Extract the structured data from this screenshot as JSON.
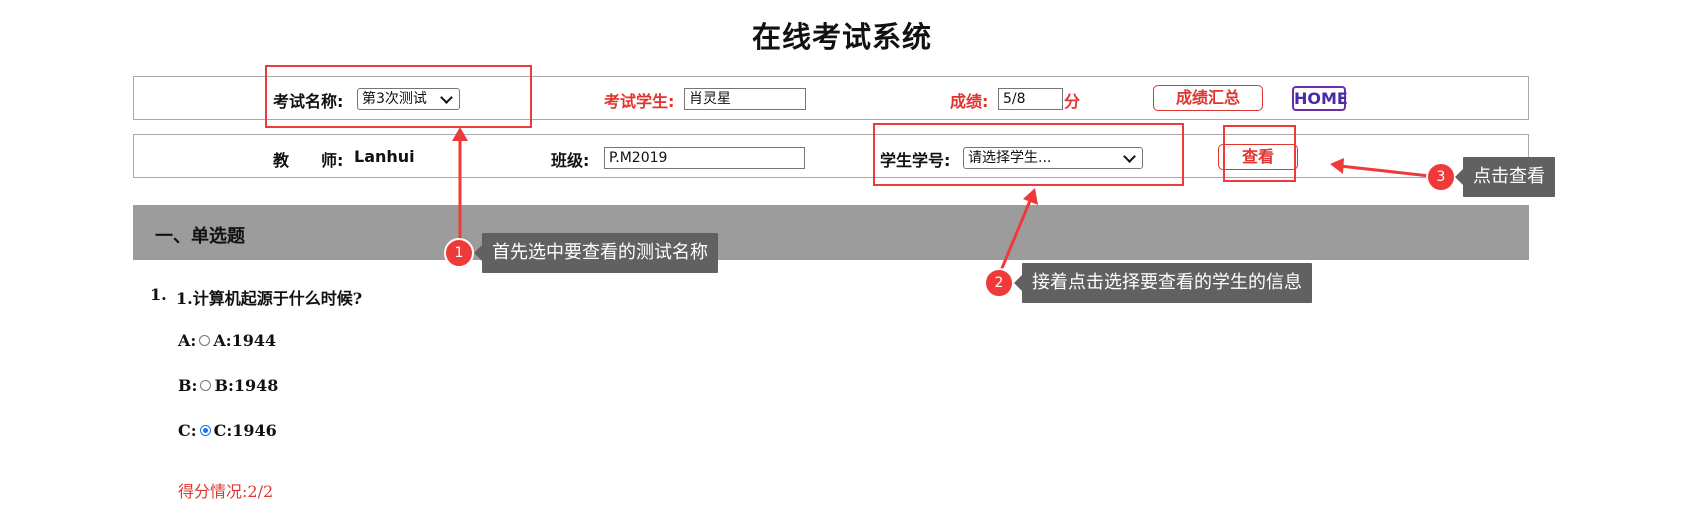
{
  "page": {
    "title": "在线考试系统"
  },
  "row1": {
    "exam_name_label": "考试名称:",
    "exam_name_selected": "第3次测试",
    "student_label": "考试学生:",
    "student_value": "肖灵星",
    "score_label": "成绩:",
    "score_value": "5/8",
    "score_unit": "分",
    "summary_button": "成绩汇总",
    "home_button": "HOME"
  },
  "row2": {
    "teacher_label": "教　　师:",
    "teacher_name": "Lanhui",
    "class_label": "班级:",
    "class_value": "P.M2019",
    "student_id_label": "学生学号:",
    "student_id_placeholder": "请选择学生...",
    "view_button": "查看"
  },
  "section": {
    "title": "一、单选题"
  },
  "question": {
    "number": "1.",
    "text": "1.计算机起源于什么时候?",
    "options": [
      {
        "prefix": "A:",
        "label": "A:1944",
        "checked": false
      },
      {
        "prefix": "B:",
        "label": "B:1948",
        "checked": false
      },
      {
        "prefix": "C:",
        "label": "C:1946",
        "checked": true
      }
    ],
    "score_text": "得分情况:2/2"
  },
  "annotations": [
    {
      "number": "1",
      "text": "首先选中要查看的测试名称"
    },
    {
      "number": "2",
      "text": "接着点击选择要查看的学生的信息"
    },
    {
      "number": "3",
      "text": "点击查看"
    }
  ],
  "colors": {
    "accent_red": "#e0352f",
    "annotation_red": "#f03a3a",
    "home_purple": "#6a2fa8",
    "section_gray": "#9c9c9c",
    "tooltip_gray": "#616161",
    "radio_blue": "#1a73e8"
  }
}
